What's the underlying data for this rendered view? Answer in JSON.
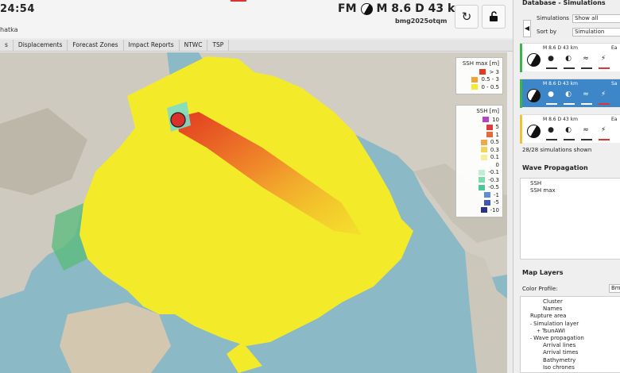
{
  "header": {
    "clock": "24:54",
    "region": "hatka",
    "magnitude": "M 8.6",
    "depth": "D 43 km",
    "mechanism_prefix": "FM",
    "event_id": "bmg2025otqm",
    "refresh_icon": "refresh-icon",
    "lock_icon": "unlock-icon"
  },
  "tabs": [
    "s",
    "Displacements",
    "Forecast Zones",
    "Impact Reports",
    "NTWC",
    "TSP"
  ],
  "map": {
    "legend_max": {
      "title": "SSH max [m]",
      "entries": [
        {
          "label": "> 3",
          "color": "#e23a20"
        },
        {
          "label": "0.5 - 3",
          "color": "#f2a23a"
        },
        {
          "label": "0 - 0.5",
          "color": "#f4ea36"
        }
      ]
    },
    "legend_ssh": {
      "title": "SSH [m]",
      "entries": [
        {
          "label": "10",
          "color": "#b443c8"
        },
        {
          "label": "5",
          "color": "#e03a3a"
        },
        {
          "label": "1",
          "color": "#e36a3a"
        },
        {
          "label": "0.5",
          "color": "#f2a748"
        },
        {
          "label": "0.3",
          "color": "#f5d35a"
        },
        {
          "label": "0.1",
          "color": "#f7ee9a"
        },
        {
          "label": "0",
          "color": "#ffffff"
        },
        {
          "label": "-0.1",
          "color": "#bfeed3"
        },
        {
          "label": "-0.3",
          "color": "#7ddcad"
        },
        {
          "label": "-0.5",
          "color": "#4fc59a"
        },
        {
          "label": "-1",
          "color": "#5c8fd0"
        },
        {
          "label": "-5",
          "color": "#4257b5"
        },
        {
          "label": "-10",
          "color": "#2b2f8f"
        }
      ]
    }
  },
  "panel": {
    "title": "Database - Simulations",
    "simulations_label": "Simulations",
    "simulations_value": "Show all",
    "sort_label": "Sort by",
    "sort_value": "Simulation",
    "sims": [
      {
        "header": "M 8.6   D  43 km",
        "tail": "Ea",
        "stripe": "#3cb44b",
        "selected": false
      },
      {
        "header": "M 8.6   D  43 km",
        "tail": "Sa",
        "stripe": "#3cb44b",
        "selected": true
      },
      {
        "header": "M 8.6   D  43 km",
        "tail": "Ea",
        "stripe": "#f1c232",
        "selected": false
      }
    ],
    "count": "28/28 simulations shown",
    "wave_title": "Wave Propagation",
    "wave_items": [
      "SSH",
      "SSH max"
    ],
    "layers_title": "Map Layers",
    "color_profile_label": "Color Profile:",
    "color_profile_value": "Bm",
    "layers": [
      {
        "label": "Cluster",
        "indent": 3,
        "toggle": ""
      },
      {
        "label": "Names",
        "indent": 3,
        "toggle": ""
      },
      {
        "label": "Rupture area",
        "indent": 1,
        "toggle": ""
      },
      {
        "label": "Simulation layer",
        "indent": 1,
        "toggle": "-"
      },
      {
        "label": "TsunAWI",
        "indent": 2,
        "toggle": "+"
      },
      {
        "label": "Wave propagation",
        "indent": 1,
        "toggle": "-"
      },
      {
        "label": "Arrival lines",
        "indent": 3,
        "toggle": ""
      },
      {
        "label": "Arrival times",
        "indent": 3,
        "toggle": ""
      },
      {
        "label": "Bathymetry",
        "indent": 3,
        "toggle": ""
      },
      {
        "label": "Iso chrones",
        "indent": 3,
        "toggle": ""
      }
    ]
  }
}
